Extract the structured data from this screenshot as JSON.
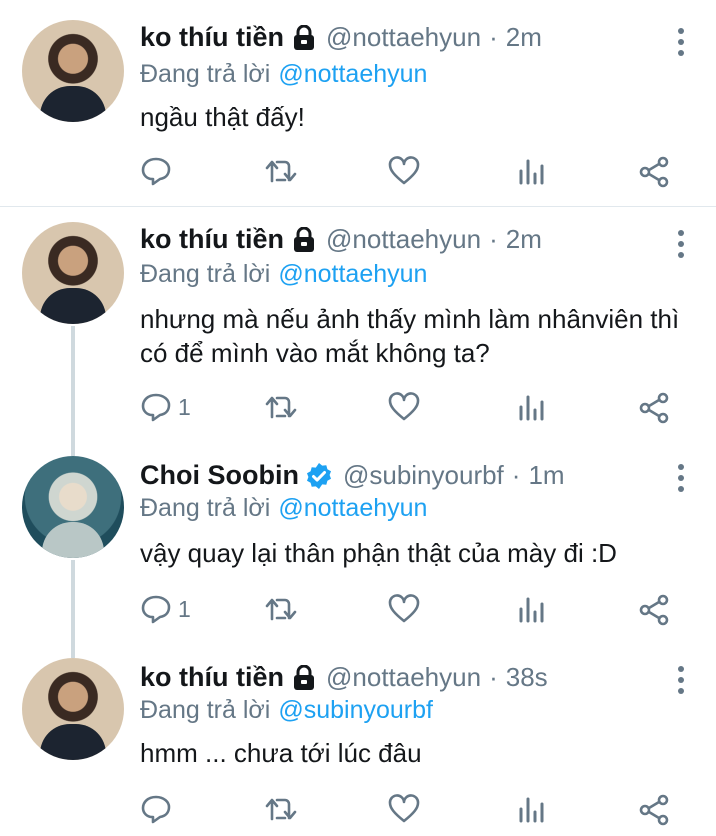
{
  "tweets": [
    {
      "name": "ko thíu tiền",
      "handle": "@nottaehyun",
      "time": "2m",
      "reply_prefix": "Đang trả lời",
      "reply_to": "@nottaehyun",
      "text": "ngầu thật đấy!",
      "reply_count": "",
      "locked": true,
      "verified": false
    },
    {
      "name": "ko thíu tiền",
      "handle": "@nottaehyun",
      "time": "2m",
      "reply_prefix": "Đang trả lời",
      "reply_to": "@nottaehyun",
      "text": "nhưng mà nếu ảnh thấy mình làm nhânviên thì có để mình vào mắt không ta?",
      "reply_count": "1",
      "locked": true,
      "verified": false
    },
    {
      "name": "Choi Soobin",
      "handle": "@subinyourbf",
      "time": "1m",
      "reply_prefix": "Đang trả lời",
      "reply_to": "@nottaehyun",
      "text": "vậy quay lại thân phận thật của mày đi :D",
      "reply_count": "1",
      "locked": false,
      "verified": true
    },
    {
      "name": "ko thíu tiền",
      "handle": "@nottaehyun",
      "time": "38s",
      "reply_prefix": "Đang trả lời",
      "reply_to": "@subinyourbf",
      "text": "hmm ... chưa tới lúc đâu",
      "reply_count": "",
      "locked": true,
      "verified": false
    }
  ],
  "separator": "·",
  "icons": {
    "reply": "reply-icon",
    "retweet": "retweet-icon",
    "like": "heart-icon",
    "analytics": "analytics-icon",
    "share": "share-icon",
    "lock": "lock-icon",
    "verified": "verified-badge-icon",
    "more": "more-options-icon"
  },
  "colors": {
    "text": "#14171a",
    "muted": "#657786",
    "link": "#1da1f2",
    "verified": "#1da1f2",
    "thread_line": "#cfd9de"
  }
}
